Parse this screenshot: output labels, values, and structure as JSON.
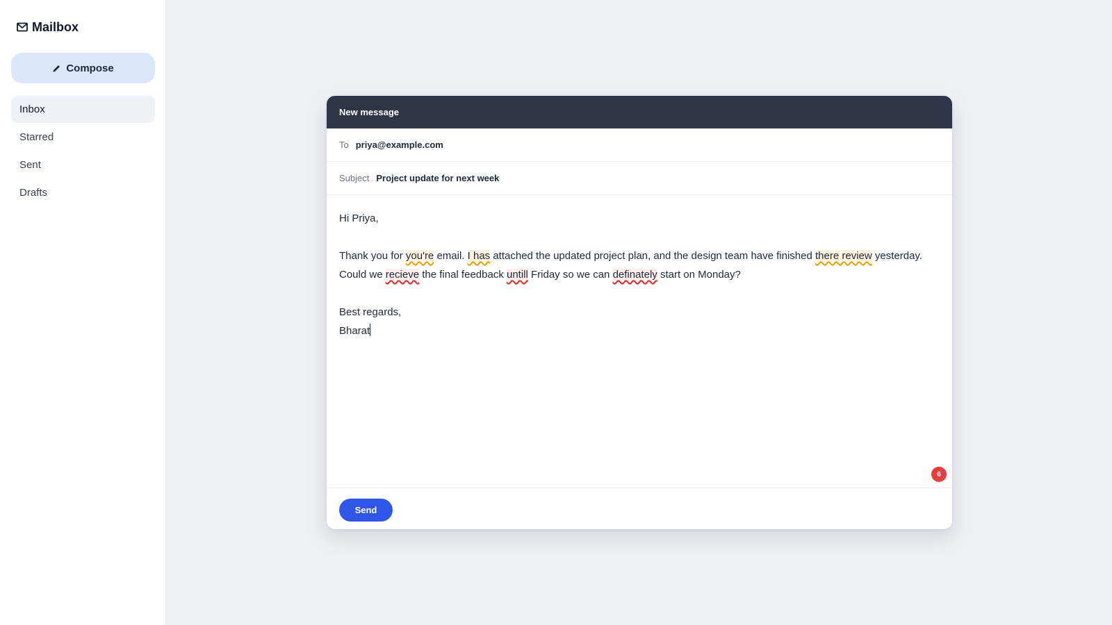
{
  "app": {
    "title": "Mailbox",
    "icon": "mail-icon"
  },
  "sidebar": {
    "compose_label": "Compose",
    "compose_icon": "pencil-icon",
    "items": [
      {
        "label": "Inbox",
        "active": true
      },
      {
        "label": "Starred",
        "active": false
      },
      {
        "label": "Sent",
        "active": false
      },
      {
        "label": "Drafts",
        "active": false
      }
    ]
  },
  "composer": {
    "title": "New message",
    "to_label": "To",
    "to_value": "priya@example.com",
    "subject_label": "Subject",
    "subject_value": "Project update for next week",
    "body": {
      "greeting": "Hi Priya,",
      "p1_a": "Thank you for ",
      "err_youre": "you're",
      "p1_b": " email. ",
      "err_i_has": "I has",
      "p1_c": " attached the updated project plan, and the design team have finished ",
      "err_there_review": "there review",
      "p1_d": " yesterday. Could we ",
      "err_recieve": "recieve",
      "p1_e": " the final feedback ",
      "err_untill": "untill",
      "p1_f": " Friday so we can ",
      "err_definately": "definately",
      "p1_g": " start on Monday?",
      "closing": "Best regards,",
      "signature": "Bharat"
    },
    "issue_count": "6",
    "send_label": "Send"
  },
  "colors": {
    "header_bg": "#2d3547",
    "send_button": "#2f56e6",
    "compose_bg": "#dbe6fb",
    "badge": "#e53e3e",
    "grammar_underline": "#e2a100",
    "spelling_underline": "#dc2626"
  }
}
